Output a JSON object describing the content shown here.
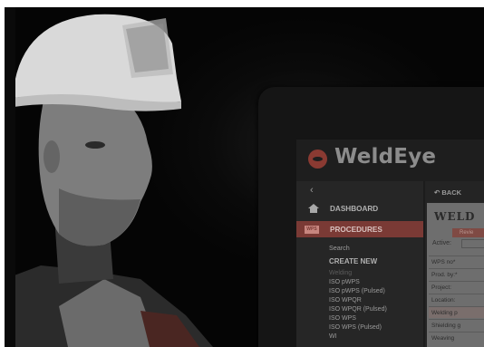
{
  "app": {
    "logo_text": "WeldEye",
    "brand_color": "#8a3a32"
  },
  "sidebar": {
    "collapse_icon": "chevron-left-icon",
    "collapse_glyph": "‹",
    "items": [
      {
        "label": "DASHBOARD",
        "icon": "house-icon"
      },
      {
        "label": "PROCEDURES",
        "icon": "wps-icon",
        "icon_text": "WPS",
        "active": true
      }
    ],
    "search_label": "Search",
    "create_new_label": "CREATE NEW",
    "create_items": [
      {
        "label": "Welding",
        "type": "category"
      },
      {
        "label": "ISO pWPS"
      },
      {
        "label": "ISO pWPS (Pulsed)"
      },
      {
        "label": "ISO WPQR"
      },
      {
        "label": "ISO WPQR (Pulsed)"
      },
      {
        "label": "ISO WPS"
      },
      {
        "label": "ISO WPS (Pulsed)"
      },
      {
        "label": "WI"
      }
    ]
  },
  "content": {
    "back_label": "BACK",
    "title": "WELD",
    "review_label": "Revie",
    "active_label": "Active:",
    "fields": [
      {
        "label": "WPS no*"
      },
      {
        "label": "Prod. by:*"
      },
      {
        "label": "Project:"
      },
      {
        "label": "Location:"
      },
      {
        "label": "Welding p",
        "highlight": true
      },
      {
        "label": "Shielding g"
      },
      {
        "label": "Weaving"
      }
    ]
  }
}
